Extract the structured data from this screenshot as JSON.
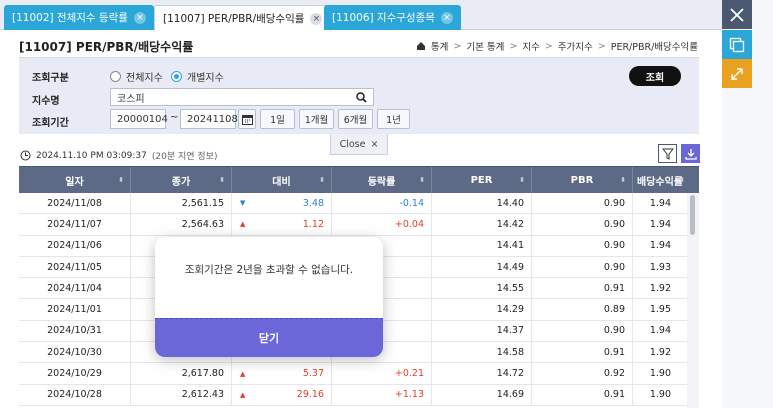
{
  "tabs": [
    {
      "label": "[11002] 전체지수 등락률",
      "active": false
    },
    {
      "label": "[11007] PER/PBR/배당수익률",
      "active": true
    },
    {
      "label": "[11006] 지수구성종목",
      "active": false
    }
  ],
  "tab_close": "×",
  "page_title": "[11007] PER/PBR/배당수익률",
  "breadcrumb": [
    "통계",
    "기본 통계",
    "지수",
    "주가지수",
    "PER/PBR/배당수익률"
  ],
  "breadcrumb_sep": ">",
  "form": {
    "type_label": "조회구분",
    "radio_all": "전체지수",
    "radio_single": "개별지수",
    "index_label": "지수명",
    "index_value": "코스피",
    "period_label": "조회기간",
    "date_from": "20000104",
    "tilde": "~",
    "date_to": "20241108",
    "periods": [
      "1일",
      "1개월",
      "6개월",
      "1년"
    ],
    "query_button": "조회",
    "close_label": "Close",
    "close_x": "×"
  },
  "timestamp": "2024.11.10 PM 03:09:37",
  "delay_note": "(20분 지연 정보)",
  "columns": [
    "일자",
    "종가",
    "대비",
    "등락률",
    "PER",
    "PBR",
    "배당수익률"
  ],
  "sort_glyph": "⬍",
  "rows": [
    {
      "date": "2024/11/08",
      "close": "2,561.15",
      "dir": "▼",
      "chg": "3.48",
      "rate": "-0.14",
      "per": "14.40",
      "pbr": "0.90",
      "div": "1.94",
      "cls": "down"
    },
    {
      "date": "2024/11/07",
      "close": "2,564.63",
      "dir": "▲",
      "chg": "1.12",
      "rate": "+0.04",
      "per": "14.42",
      "pbr": "0.90",
      "div": "1.94",
      "cls": "up"
    },
    {
      "date": "2024/11/06",
      "close": "",
      "dir": "",
      "chg": "",
      "rate": "",
      "per": "14.41",
      "pbr": "0.90",
      "div": "1.94",
      "cls": ""
    },
    {
      "date": "2024/11/05",
      "close": "",
      "dir": "",
      "chg": "",
      "rate": "",
      "per": "14.49",
      "pbr": "0.90",
      "div": "1.93",
      "cls": ""
    },
    {
      "date": "2024/11/04",
      "close": "",
      "dir": "",
      "chg": "",
      "rate": "",
      "per": "14.55",
      "pbr": "0.91",
      "div": "1.92",
      "cls": ""
    },
    {
      "date": "2024/11/01",
      "close": "",
      "dir": "",
      "chg": "",
      "rate": "",
      "per": "14.29",
      "pbr": "0.89",
      "div": "1.95",
      "cls": ""
    },
    {
      "date": "2024/10/31",
      "close": "",
      "dir": "",
      "chg": "",
      "rate": "",
      "per": "14.37",
      "pbr": "0.90",
      "div": "1.94",
      "cls": ""
    },
    {
      "date": "2024/10/30",
      "close": "",
      "dir": "",
      "chg": "",
      "rate": "",
      "per": "14.58",
      "pbr": "0.91",
      "div": "1.92",
      "cls": ""
    },
    {
      "date": "2024/10/29",
      "close": "2,617.80",
      "dir": "▲",
      "chg": "5.37",
      "rate": "+0.21",
      "per": "14.72",
      "pbr": "0.92",
      "div": "1.90",
      "cls": "up"
    },
    {
      "date": "2024/10/28",
      "close": "2,612.43",
      "dir": "▲",
      "chg": "29.16",
      "rate": "+1.13",
      "per": "14.69",
      "pbr": "0.91",
      "div": "1.90",
      "cls": "up"
    }
  ],
  "modal": {
    "message": "조회기간은 2년을 초과할 수 없습니다.",
    "ok_button": "닫기"
  },
  "colors": {
    "accent": "#2ba6d8",
    "header": "#5d6a85",
    "modal_button": "#6b67d8",
    "up": "#e0402e",
    "down": "#2a7fd0"
  }
}
